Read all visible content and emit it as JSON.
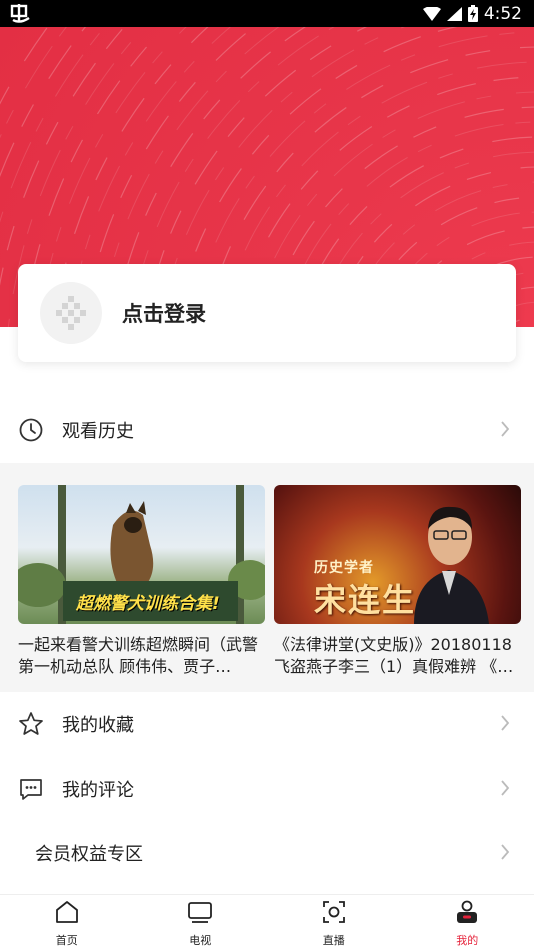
{
  "status_bar": {
    "time": "4:52"
  },
  "login": {
    "label": "点击登录"
  },
  "menu": {
    "history_label": "观看历史",
    "favorites_label": "我的收藏",
    "comments_label": "我的评论",
    "vip_label": "会员权益专区"
  },
  "history_items": [
    {
      "title": "一起来看警犬训练超燃瞬间（武警第一机动总队 顾伟伟、贾子…",
      "thumb_caption": "超燃警犬训练合集!"
    },
    {
      "title": "《法律讲堂(文史版)》20180118 飞盗燕子李三（1）真假难辨 《…",
      "thumb_caption_top": "历史学者",
      "thumb_caption_name": "宋连生"
    }
  ],
  "bottom_nav": {
    "home": "首页",
    "tv": "电视",
    "live": "直播",
    "mine": "我的"
  },
  "colors": {
    "accent": "#e5233b",
    "banner": "#e8364a"
  }
}
